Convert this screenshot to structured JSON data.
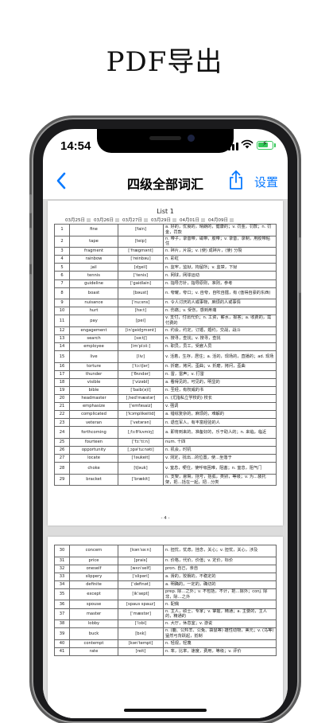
{
  "headline": "PDF导出",
  "status": {
    "time": "14:54"
  },
  "nav": {
    "title": "四级全部词汇",
    "settings_label": "设置"
  },
  "pdf": {
    "list_title": "List 1",
    "dates": [
      "03月25日",
      "03月26日",
      "03月27日",
      "03月29日",
      "04月01日",
      "04月09日"
    ],
    "page1_number": "- 4 -",
    "page1_rows": [
      {
        "no": "1",
        "word": "fine",
        "phonetic": "[fain]",
        "definition": "a. 好的，优良的，晴朗的，健康的；v. 罚金，罚款；n. 罚金，罚款",
        "tall": true
      },
      {
        "no": "2",
        "word": "tape",
        "phonetic": "[teip]",
        "definition": "n. 带子，录音带，磁带，胶带；v. 录音，录制，用胶带粘住",
        "tall": true
      },
      {
        "no": "3",
        "word": "fragment",
        "phonetic": "[ˈfrægmənt]",
        "definition": "n. 碎片，片段；v. (使) 成碎片，(使) 分裂",
        "tall": false
      },
      {
        "no": "4",
        "word": "rainbow",
        "phonetic": "[ˈreinbəu]",
        "definition": "n. 彩虹",
        "tall": false
      },
      {
        "no": "5",
        "word": "jail",
        "phonetic": "[dʒeil]",
        "definition": "n. 监牢，监狱，拘留所；v. 监禁，下狱",
        "tall": false
      },
      {
        "no": "6",
        "word": "tennis",
        "phonetic": "[ˈtenis]",
        "definition": "n. 网球，网球运动",
        "tall": false
      },
      {
        "no": "7",
        "word": "guideline",
        "phonetic": "[ˈgaidlain]",
        "definition": "n. 指导方针，指导原则，准则，参考",
        "tall": false
      },
      {
        "no": "8",
        "word": "boast",
        "phonetic": "[bəust]",
        "definition": "n. 夸耀，夸口；v. 自夸，自吹自擂，有 (值得自豪的东西)",
        "tall": true
      },
      {
        "no": "9",
        "word": "nuisance",
        "phonetic": "[ˈnuːsns]",
        "definition": "n. 令人讨厌的人或事物，麻烦的人或事情",
        "tall": false
      },
      {
        "no": "10",
        "word": "hurt",
        "phonetic": "[həːt]",
        "definition": "n. 伤痛；v. 受伤，感到疼痛",
        "tall": false
      },
      {
        "no": "11",
        "word": "pay",
        "phonetic": "[pei]",
        "definition": "v. 支付，付出代价；n. 工资，薪水，报答；a. 收费的，需付费的",
        "tall": true
      },
      {
        "no": "12",
        "word": "engagement",
        "phonetic": "[inˈgeidʒmənt]",
        "definition": "n. 约会，约定，订婚，婚约，交战，战斗",
        "tall": false
      },
      {
        "no": "13",
        "word": "search",
        "phonetic": "[səːtʃ]",
        "definition": "n. 搜寻，查找；v. 搜寻，查找",
        "tall": false
      },
      {
        "no": "14",
        "word": "employee",
        "phonetic": "[imˈplɔiiː]",
        "definition": "n. 职员，员工，受雇人员",
        "tall": false
      },
      {
        "no": "15",
        "word": "live",
        "phonetic": "[liv]",
        "definition": "v. 活着，生存，居住；a. 活的，现场的，直播的；ad. 现场",
        "tall": true
      },
      {
        "no": "16",
        "word": "torture",
        "phonetic": "[ˈtɔːtʃər]",
        "definition": "n. 折磨，拷问，歪曲；v. 折磨，拷问，歪曲",
        "tall": false
      },
      {
        "no": "17",
        "word": "thunder",
        "phonetic": "[ˈθʌndər]",
        "definition": "n. 雷，雷声；v. 打雷",
        "tall": false
      },
      {
        "no": "18",
        "word": "visible",
        "phonetic": "[ˈvizəbl]",
        "definition": "a. 看得见的，可见的，明显的",
        "tall": false
      },
      {
        "no": "19",
        "word": "bible",
        "phonetic": "[ˈbaib(ə)l]",
        "definition": "n. 圣经，有权威的书",
        "tall": false
      },
      {
        "no": "20",
        "word": "headmaster",
        "phonetic": "[ˌhedˈmæstər]",
        "definition": "n. (尤指私立学校的) 校长",
        "tall": false
      },
      {
        "no": "21",
        "word": "emphasize",
        "phonetic": "[ˈemfəsaiz]",
        "definition": "v. 强调",
        "tall": false
      },
      {
        "no": "22",
        "word": "complicated",
        "phonetic": "[ˈkɔmplikeitid]",
        "definition": "a. 错综复杂的，麻烦的，难解的",
        "tall": false
      },
      {
        "no": "23",
        "word": "veteran",
        "phonetic": "[ˈvetərən]",
        "definition": "n. 退伍军人，有丰富经验的人",
        "tall": false
      },
      {
        "no": "24",
        "word": "forthcoming",
        "phonetic": "[ˌfɔːθˈkʌmiŋ]",
        "definition": "a. 即将到来的，准备好的，乐于助人的；n. 来临，临近",
        "tall": true
      },
      {
        "no": "25",
        "word": "fourteen",
        "phonetic": "[ˈfɔːˈtiːn]",
        "definition": "num. 十四",
        "tall": false
      },
      {
        "no": "26",
        "word": "opportunity",
        "phonetic": "[ˌɔpəˈtuːnəti]",
        "definition": "n. 机会，时机",
        "tall": false
      },
      {
        "no": "27",
        "word": "locate",
        "phonetic": "[ˈləukeit]",
        "definition": "v. 测定，找出…的位置，使…坐落于",
        "tall": false
      },
      {
        "no": "28",
        "word": "choke",
        "phonetic": "[tʃəuk]",
        "definition": "v. 窒息，哽住，使呼吸困难，阻塞；n. 窒息，阻气门",
        "tall": true
      },
      {
        "no": "29",
        "word": "bracket",
        "phonetic": "[ˈbrækit]",
        "definition": "n. 支架，悬臂，括号，括弧，类别，等级；v. 为…装托架，把…括在一起，把…分类",
        "tall": true
      }
    ],
    "page2_rows": [
      {
        "no": "30",
        "word": "concern",
        "phonetic": "[kənˈsəːn]",
        "definition": "n. 担忧，忧虑，挂念，关心；v. 担忧，关心，涉及",
        "tall": true
      },
      {
        "no": "31",
        "word": "price",
        "phonetic": "[prais]",
        "definition": "n. 价格，代价，价值；v. 定价，标价",
        "tall": false
      },
      {
        "no": "32",
        "word": "oneself",
        "phonetic": "[wʌnˈself]",
        "definition": "pron. 自己，亲自",
        "tall": false
      },
      {
        "no": "33",
        "word": "slippery",
        "phonetic": "[ˈslipəri]",
        "definition": "a. 滑的，狡猾的，不稳定的",
        "tall": false
      },
      {
        "no": "34",
        "word": "definite",
        "phonetic": "[ˈdefinət]",
        "definition": "a. 明确的，一定的，确切的",
        "tall": false
      },
      {
        "no": "35",
        "word": "except",
        "phonetic": "[ikˈsept]",
        "definition": "prep. 除…之外；v. 不包括，不计，把…除外；conj. 除非，除…之外",
        "tall": true
      },
      {
        "no": "36",
        "word": "spouse",
        "phonetic": "[spaus spauz]",
        "definition": "n. 配偶",
        "tall": false
      },
      {
        "no": "37",
        "word": "master",
        "phonetic": "[ˈmæstər]",
        "definition": "n. 主人，硕士，专家；v. 掌握，精通；a. 主要的，主人的，精通的",
        "tall": true
      },
      {
        "no": "38",
        "word": "lobby",
        "phonetic": "[ˈlɔbi]",
        "definition": "n. 大厅，休息室；v. 游说",
        "tall": false
      },
      {
        "no": "39",
        "word": "buck",
        "phonetic": "[bʌk]",
        "definition": "n. (鹿、公羚羊、公兔、袋鼠等) 雄性动物，美元；v. (马等)猛然弓背跃起，抵制",
        "tall": true
      },
      {
        "no": "40",
        "word": "contempt",
        "phonetic": "[kənˈtempt]",
        "definition": "n. 轻视，轻蔑",
        "tall": false
      },
      {
        "no": "41",
        "word": "rate",
        "phonetic": "[reit]",
        "definition": "n. 率，比率，速度，费用，等级；v. 评价",
        "tall": false
      }
    ]
  }
}
